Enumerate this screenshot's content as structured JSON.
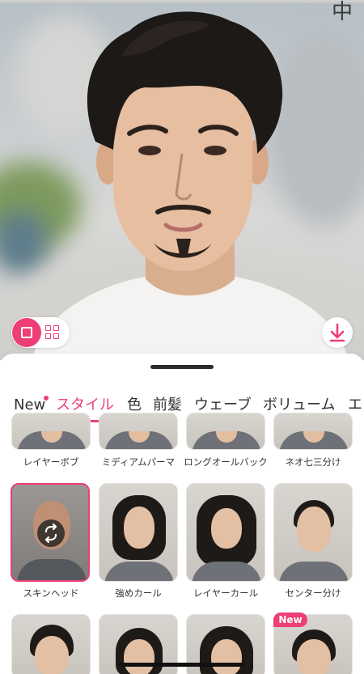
{
  "photo": {
    "corner_glyph": "中"
  },
  "view_toggle": {
    "single_icon": "single-view-icon",
    "grid_icon": "grid-view-icon"
  },
  "download": {
    "icon": "download-icon"
  },
  "tabs": [
    {
      "label": "New",
      "has_dot": true
    },
    {
      "label": "スタイル",
      "active": true
    },
    {
      "label": "色"
    },
    {
      "label": "前髪"
    },
    {
      "label": "ウェーブ"
    },
    {
      "label": "ボリューム"
    },
    {
      "label": "エ"
    }
  ],
  "row1": [
    {
      "label": "レイヤーボブ"
    },
    {
      "label": "ミディアムパーマ"
    },
    {
      "label": "ロングオールバック"
    },
    {
      "label": "ネオ七三分け"
    }
  ],
  "row2": [
    {
      "label": "スキンヘッド",
      "selected": true
    },
    {
      "label": "強めカール"
    },
    {
      "label": "レイヤーカール"
    },
    {
      "label": "センター分け"
    }
  ],
  "row3_badge": "New",
  "colors": {
    "accent": "#ee3e76"
  }
}
